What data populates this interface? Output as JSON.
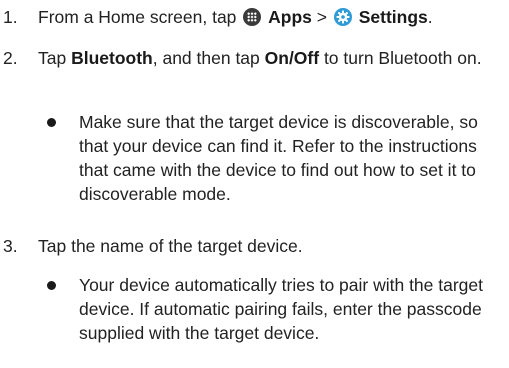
{
  "steps": [
    {
      "number": "1.",
      "prefix": "From a Home screen, tap ",
      "apps_label": "Apps",
      "separator": " > ",
      "settings_label": "Settings",
      "suffix": "."
    },
    {
      "number": "2.",
      "prefix": "Tap ",
      "bluetooth_label": "Bluetooth",
      "middle": ", and then tap ",
      "onoff_label": "On/Off",
      "suffix": " to turn Bluetooth on."
    },
    {
      "number": "3.",
      "text": "Tap the name of the target device."
    }
  ],
  "bullets": [
    {
      "text": "Make sure that the target device is discoverable, so that your device can find it. Refer to the instructions that came with the device to find out how to set it to discoverable mode."
    },
    {
      "text": "Your device automatically tries to pair with the target device. If automatic pairing fails, enter the passcode supplied with the target device."
    }
  ],
  "icons": {
    "apps": "apps-grid-icon",
    "settings": "settings-gear-icon"
  },
  "colors": {
    "text": "#222222",
    "apps_icon": "#3a3a3a",
    "settings_icon": "#2e9ad6"
  }
}
